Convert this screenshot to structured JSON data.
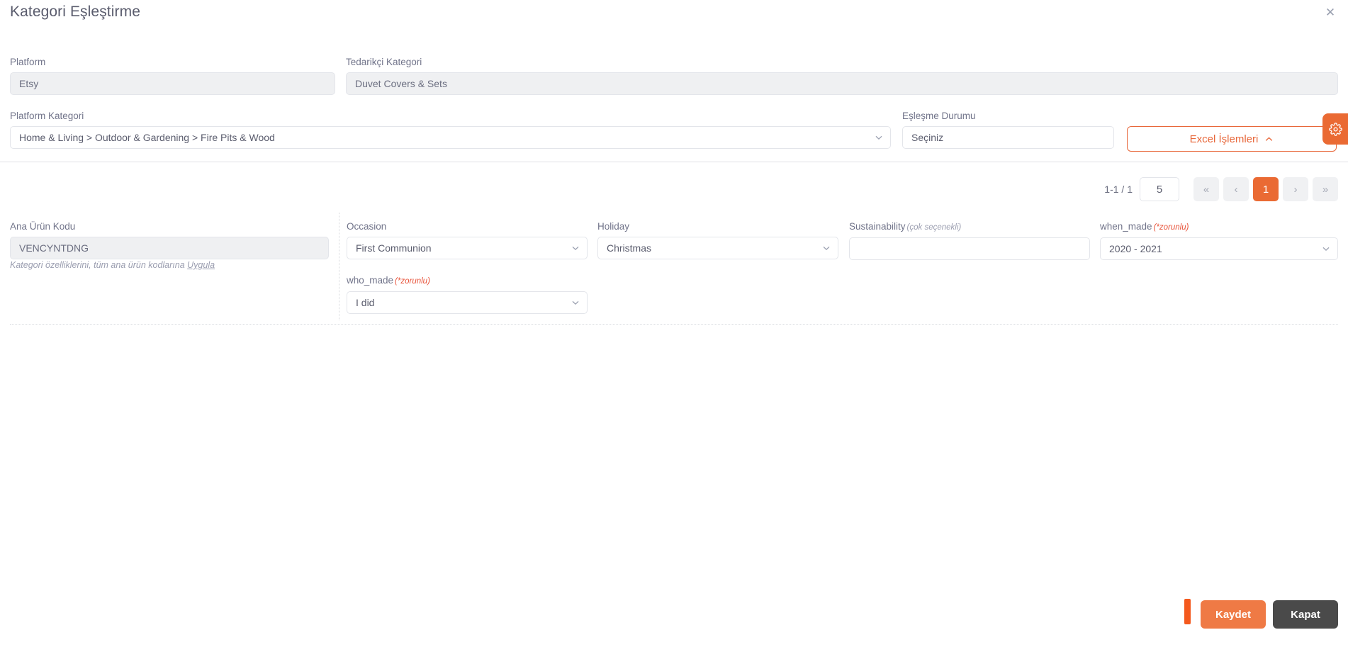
{
  "modal": {
    "title": "Kategori Eşleştirme",
    "close_icon": "close-icon"
  },
  "top_form": {
    "platform": {
      "label": "Platform",
      "value": "Etsy",
      "readonly": true
    },
    "supplier_category": {
      "label": "Tedarikçi Kategori",
      "value": "Duvet Covers & Sets",
      "readonly": true
    },
    "platform_category": {
      "label": "Platform Kategori",
      "value": "Home & Living > Outdoor & Gardening > Fire Pits & Wood",
      "caret_icon": "chevron-down-icon"
    },
    "match_status": {
      "label": "Eşleşme Durumu",
      "value": "Seçiniz",
      "caret_icon": "chevron-down-icon"
    }
  },
  "actions": {
    "excel_label": "Excel İşlemleri",
    "excel_caret_icon": "chevron-up-icon",
    "gear_icon": "gear-icon"
  },
  "pagination": {
    "range_text": "1-1 / 1",
    "page_size": "5",
    "first_label": "«",
    "prev_label": "‹",
    "current_page": "1",
    "next_label": "›",
    "last_label": "»"
  },
  "detail_form": {
    "main_product_code": {
      "label": "Ana Ürün Kodu",
      "value": "VENCYNTDNG",
      "readonly": true
    },
    "apply_note": {
      "prefix": "Kategori özelliklerini, tüm ana ürün kodlarına ",
      "link": "Uygula"
    },
    "occasion": {
      "label": "Occasion",
      "value": "First Communion",
      "caret_icon": "chevron-down-icon"
    },
    "holiday": {
      "label": "Holiday",
      "value": "Christmas",
      "caret_icon": "chevron-down-icon"
    },
    "sustainability": {
      "label": "Sustainability",
      "hint": "(çok seçenekli)",
      "value": ""
    },
    "when_made": {
      "label": "when_made",
      "required_hint": "(*zorunlu)",
      "value": "2020 - 2021",
      "caret_icon": "chevron-down-icon"
    },
    "who_made": {
      "label": "who_made",
      "required_hint": "(*zorunlu)",
      "value": "I did",
      "caret_icon": "chevron-down-icon"
    }
  },
  "footer": {
    "save_label": "Kaydet",
    "close_label": "Kapat"
  },
  "colors": {
    "accent_orange": "#ea6a33",
    "save_orange": "#ef7a45",
    "tab_orange": "#f4591d",
    "close_dark": "#4a4a4a",
    "required_red": "#e8533a",
    "text": "#5a5c6d",
    "label": "#71748a",
    "border": "#e3e5ea",
    "readonly_bg": "#eff0f2"
  }
}
